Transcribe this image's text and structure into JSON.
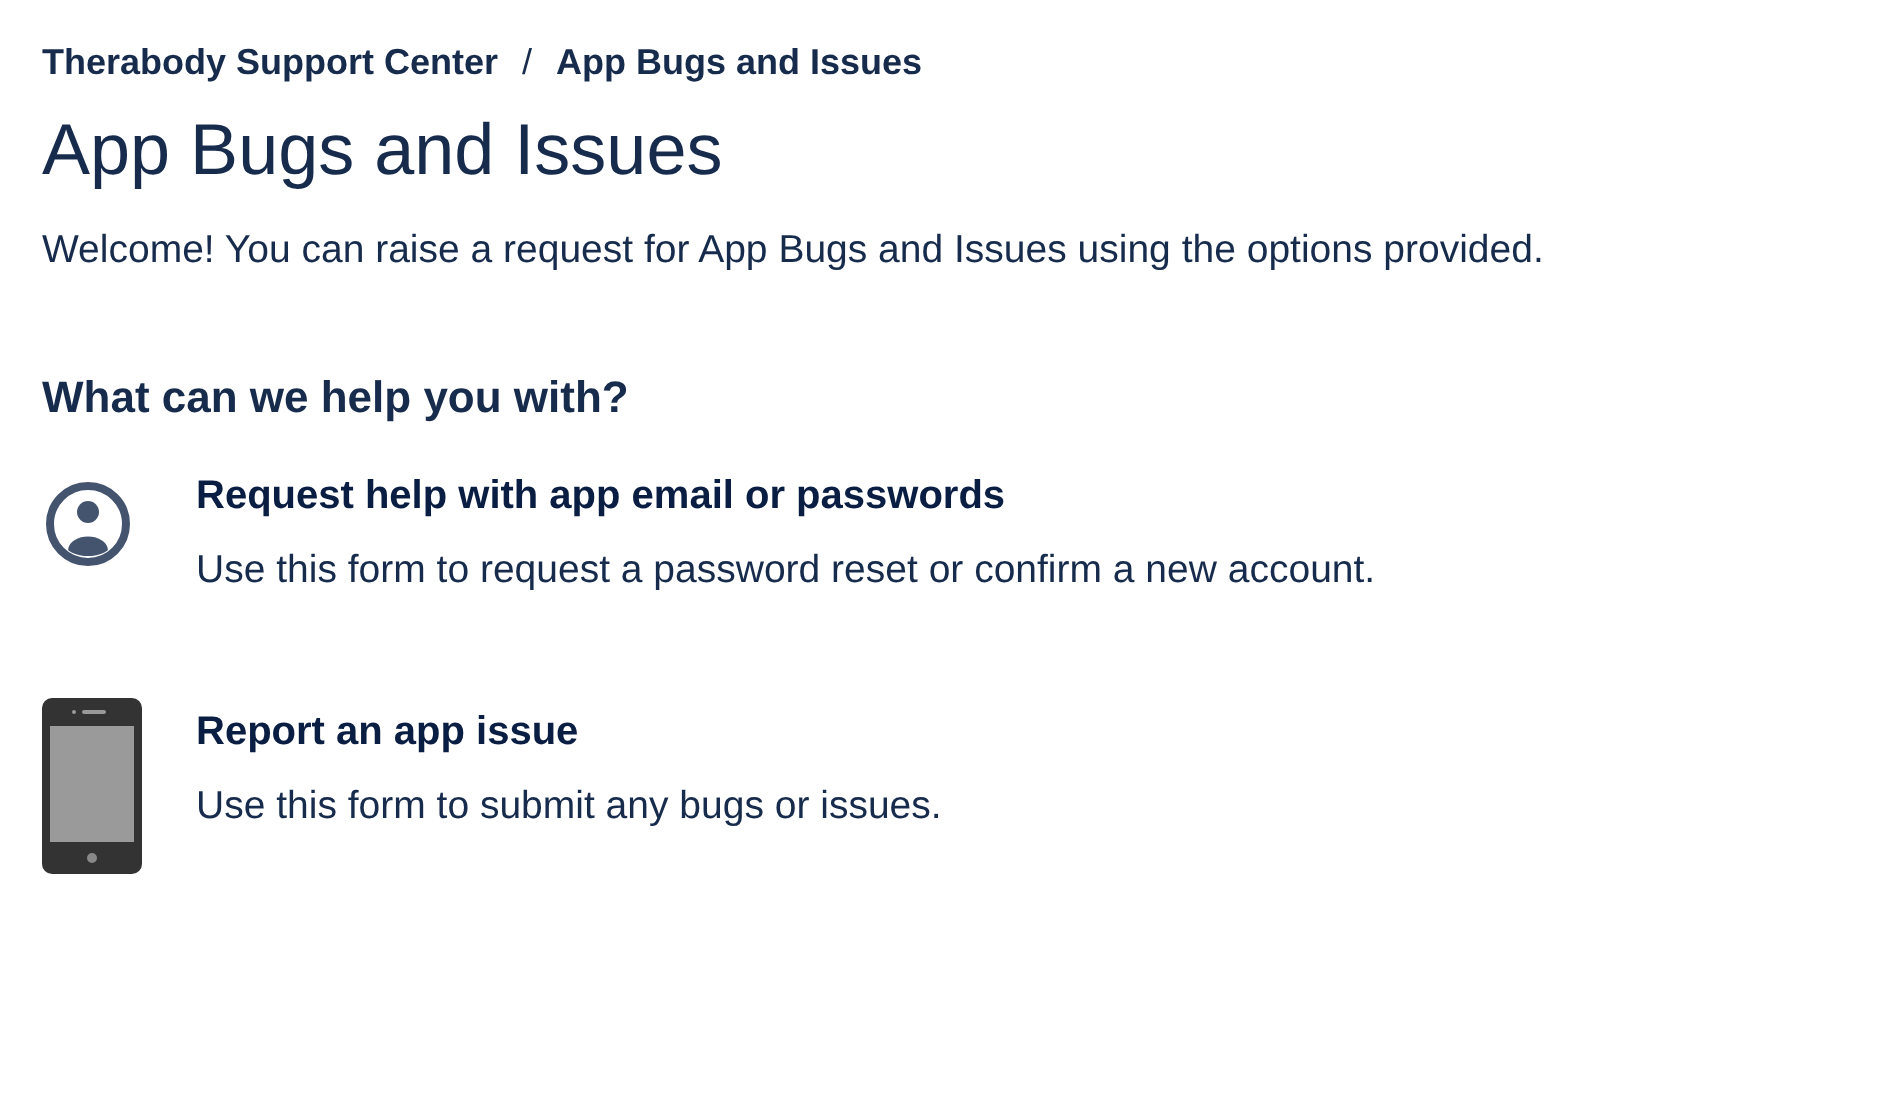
{
  "breadcrumbs": [
    {
      "label": "Therabody Support Center"
    },
    {
      "label": "App Bugs and Issues"
    }
  ],
  "separator": "/",
  "title": "App Bugs and Issues",
  "intro": "Welcome! You can raise a request for App Bugs and Issues using the options provided.",
  "section_title": "What can we help you with?",
  "options": [
    {
      "kind": "account",
      "title": "Request help with app email or passwords",
      "description": "Use this form to request a password reset or confirm a new account."
    },
    {
      "kind": "phone",
      "title": "Report an app issue",
      "description": "Use this form to submit any bugs or issues."
    }
  ]
}
